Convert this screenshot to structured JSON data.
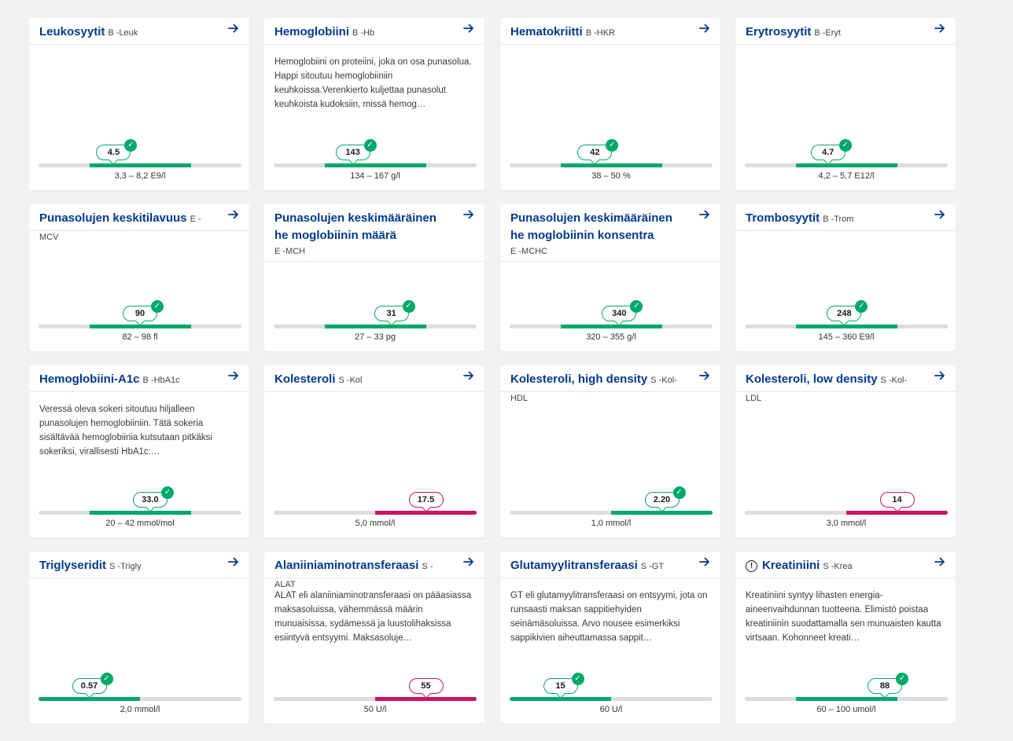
{
  "colors": {
    "ok": "#00a86b",
    "high": "#cc1466",
    "title": "#003a8c",
    "track": "#dddddd"
  },
  "cards": [
    {
      "title": "Leukosyytit",
      "code": "B -Leuk",
      "desc": "",
      "value": "4.5",
      "range": "3,3 – 8,2 E9/l",
      "status": "ok",
      "check": true,
      "marker": 0.37,
      "fill": [
        0.25,
        0.75
      ],
      "code_newline": false,
      "alert": false
    },
    {
      "title": "Hemoglobiini",
      "code": "B -Hb",
      "desc": "Hemoglobiini on proteiini, joka on osa punasolua. Happi sitoutuu hemoglobiiniin keuhkoissa.Verenkierto kuljettaa punasolut keuhkoista kudoksiin, missä hemog…",
      "value": "143",
      "range": "134 – 167 g/l",
      "status": "ok",
      "check": true,
      "marker": 0.39,
      "fill": [
        0.25,
        0.75
      ],
      "code_newline": false,
      "alert": false
    },
    {
      "title": "Hematokriitti",
      "code": "B -HKR",
      "desc": "",
      "value": "42",
      "range": "38 – 50 %",
      "status": "ok",
      "check": true,
      "marker": 0.42,
      "fill": [
        0.25,
        0.75
      ],
      "code_newline": false,
      "alert": false
    },
    {
      "title": "Erytrosyytit",
      "code": "B -Eryt",
      "desc": "",
      "value": "4.7",
      "range": "4,2 – 5,7 E12/l",
      "status": "ok",
      "check": true,
      "marker": 0.41,
      "fill": [
        0.25,
        0.75
      ],
      "code_newline": false,
      "alert": false
    },
    {
      "title": "Punasolujen keskitilavuus",
      "code": "E -MCV",
      "desc": "",
      "value": "90",
      "range": "82 – 98 fl",
      "status": "ok",
      "check": true,
      "marker": 0.5,
      "fill": [
        0.25,
        0.75
      ],
      "code_newline": false,
      "alert": false
    },
    {
      "title": "Punasolujen keskimääräinen he moglobiinin määrä",
      "code": "E -MCH",
      "desc": "",
      "value": "31",
      "range": "27 – 33 pg",
      "status": "ok",
      "check": true,
      "marker": 0.58,
      "fill": [
        0.25,
        0.75
      ],
      "code_newline": true,
      "alert": false
    },
    {
      "title": "Punasolujen keskimääräinen he moglobiinin konsentra",
      "code": "E -MCHC",
      "desc": "",
      "value": "340",
      "range": "320 – 355 g/l",
      "status": "ok",
      "check": true,
      "marker": 0.54,
      "fill": [
        0.25,
        0.75
      ],
      "code_newline": true,
      "alert": false
    },
    {
      "title": "Trombosyytit",
      "code": "B -Trom",
      "desc": "",
      "value": "248",
      "range": "145 – 360 E9/l",
      "status": "ok",
      "check": true,
      "marker": 0.49,
      "fill": [
        0.25,
        0.75
      ],
      "code_newline": false,
      "alert": false
    },
    {
      "title": "Hemoglobiini-A1c",
      "code": "B -HbA1c",
      "desc": "Veressä oleva sokeri sitoutuu hiljalleen punasolujen hemoglobiiniin. Tätä sokeria sisältävää hemoglobiinia kutsutaan pitkäksi sokeriksi, virallisesti HbA1c:…",
      "value": "33.0",
      "range": "20 – 42 mmol/mol",
      "status": "ok",
      "check": true,
      "marker": 0.55,
      "fill": [
        0.25,
        0.75
      ],
      "code_newline": false,
      "alert": false
    },
    {
      "title": "Kolesteroli",
      "code": "S -Kol",
      "desc": "",
      "value": "17.5",
      "range": "5,0 mmol/l",
      "status": "high",
      "check": false,
      "marker": 0.75,
      "fill": [
        0.5,
        1.0
      ],
      "code_newline": false,
      "alert": false
    },
    {
      "title": "Kolesteroli, high density",
      "code": "S -Kol-HDL",
      "desc": "",
      "value": "2.20",
      "range": "1,0 mmol/l",
      "status": "ok",
      "check": true,
      "marker": 0.75,
      "fill": [
        0.5,
        1.0
      ],
      "code_newline": false,
      "alert": false
    },
    {
      "title": "Kolesteroli, low density",
      "code": "S -Kol-LDL",
      "desc": "",
      "value": "14",
      "range": "3,0 mmol/l",
      "status": "high",
      "check": false,
      "marker": 0.75,
      "fill": [
        0.5,
        1.0
      ],
      "code_newline": false,
      "alert": false
    },
    {
      "title": "Triglyseridit",
      "code": "S -Trigly",
      "desc": "",
      "value": "0.57",
      "range": "2,0 mmol/l",
      "status": "ok",
      "check": true,
      "marker": 0.25,
      "fill": [
        0.0,
        0.5
      ],
      "code_newline": false,
      "alert": false
    },
    {
      "title": "Alaniiniaminotransferaasi",
      "code": "S -ALAT",
      "desc": "ALAT eli alaniiniaminotransferaasi on pääasiassa maksasoluissa, vähemmässä määrin munuaisissa, sydämessä ja luustolihaksissa esiintyvä entsyymi. Maksasoluje…",
      "value": "55",
      "range": "50 U/l",
      "status": "high",
      "check": false,
      "marker": 0.75,
      "fill": [
        0.5,
        1.0
      ],
      "code_newline": false,
      "alert": false
    },
    {
      "title": "Glutamyylitransferaasi",
      "code": "S -GT",
      "desc": "GT eli glutamyylitransferaasi on entsyymi, jota on runsaasti maksan sappitiehyiden seinämäsoluissa. Arvo nousee esimerkiksi sappikivien aiheuttamassa sappit…",
      "value": "15",
      "range": "60 U/l",
      "status": "ok",
      "check": true,
      "marker": 0.25,
      "fill": [
        0.0,
        0.5
      ],
      "code_newline": false,
      "alert": false
    },
    {
      "title": "Kreatiniini",
      "code": "S -Krea",
      "desc": "Kreatiniini syntyy lihasten energia-aineenvaihdunnan tuotteena. Elimistö poistaa kreatiniinin suodattamalla sen munuaisten kautta virtsaan. Kohonneet kreati…",
      "value": "88",
      "range": "60 – 100 umol/l",
      "status": "ok",
      "check": true,
      "marker": 0.69,
      "fill": [
        0.25,
        0.75
      ],
      "code_newline": false,
      "alert": true
    }
  ]
}
